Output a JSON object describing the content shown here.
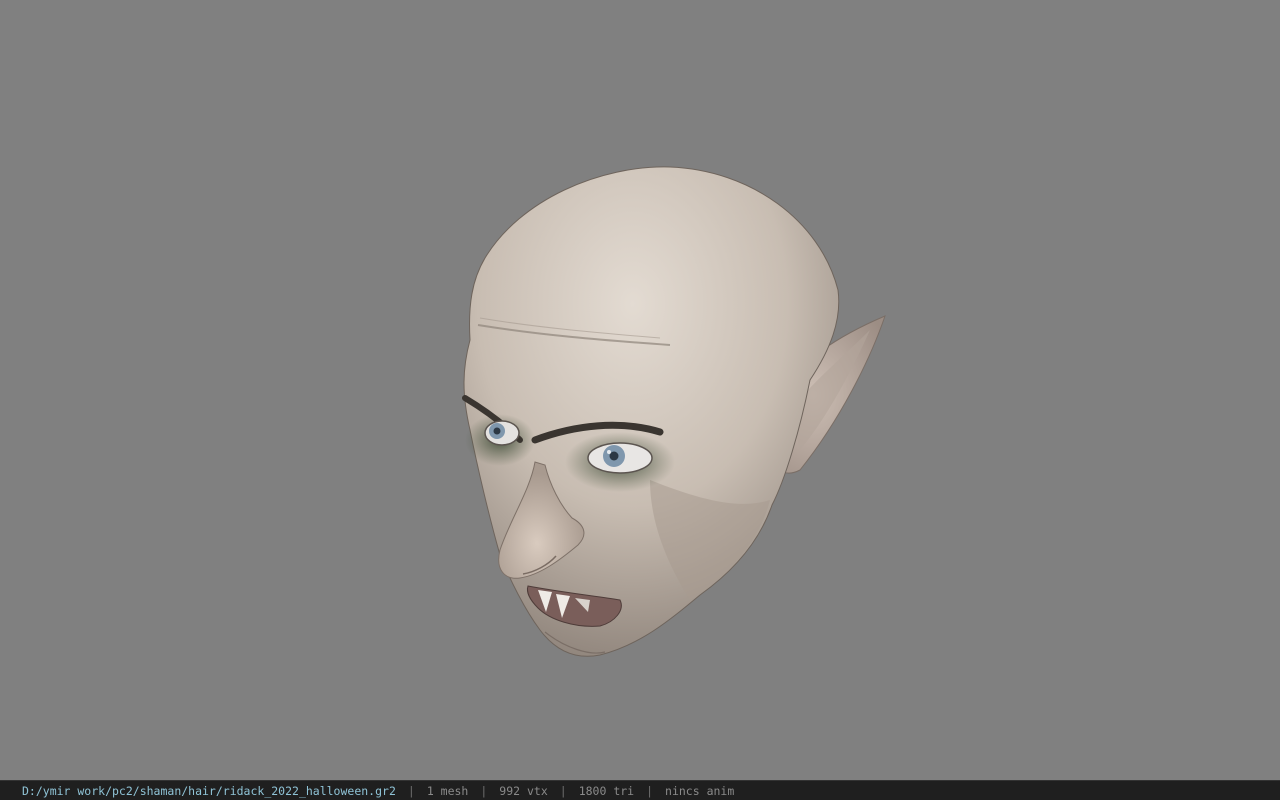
{
  "status_bar": {
    "file_path": "D:/ymir work/pc2/shaman/hair/ridack_2022_halloween.gr2",
    "separator": "|",
    "mesh_count": "1 mesh",
    "vertex_count": "992 vtx",
    "triangle_count": "1800 tri",
    "anim_status": "nincs anim"
  },
  "colors": {
    "viewport_background": "#808080",
    "status_bar_background": "#1f1f1f",
    "path_text": "#8fc3d6",
    "stat_text": "#8a8a8a"
  }
}
